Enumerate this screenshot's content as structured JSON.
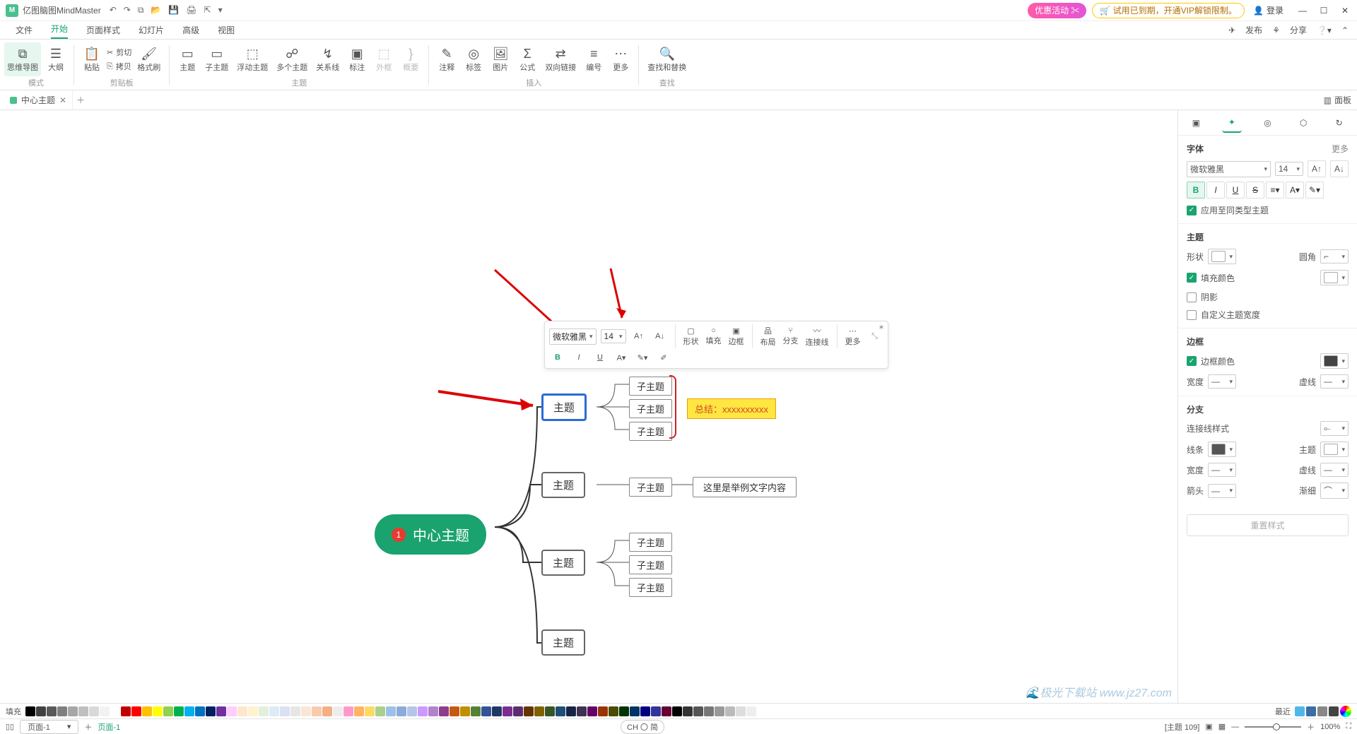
{
  "title_bar": {
    "app_name": "亿图脑图MindMaster",
    "promo1": "优惠活动 ✂",
    "promo2": "🛒 试用已到期，开通VIP解锁限制。",
    "login": "登录"
  },
  "menu": {
    "items": [
      "文件",
      "开始",
      "页面样式",
      "幻灯片",
      "高级",
      "视图"
    ],
    "active": 1
  },
  "right_icons": {
    "publish": "发布",
    "share": "分享"
  },
  "ribbon": {
    "mode": {
      "mindmap": "思维导图",
      "outline": "大纲",
      "label": "模式"
    },
    "clipboard": {
      "paste": "粘贴",
      "cut": "剪切",
      "copy": "拷贝",
      "format": "格式刷",
      "label": "剪贴板"
    },
    "topic": {
      "topic": "主题",
      "subtopic": "子主题",
      "float": "浮动主题",
      "multi": "多个主题",
      "relation": "关系线",
      "callout": "标注",
      "boundary": "外框",
      "summary": "概要",
      "label": "主题"
    },
    "insert": {
      "note": "注释",
      "tag": "标签",
      "image": "图片",
      "formula": "公式",
      "hyperlink": "双向链接",
      "number": "编号",
      "more": "更多",
      "label": "插入"
    },
    "search": {
      "find": "查找和替换",
      "label": "查找"
    }
  },
  "tab": {
    "doc_name": "中心主题",
    "panel_btn": "面板"
  },
  "canvas": {
    "center": "中心主题",
    "badge": "1",
    "topics": [
      "主题",
      "主题",
      "主题",
      "主题"
    ],
    "subs": [
      "子主题",
      "子主题",
      "子主题",
      "子主题",
      "子主题",
      "子主题",
      "子主题"
    ],
    "note1": "总结：xxxxxxxxxx",
    "note2": "这里是举例文字内容"
  },
  "float_tb": {
    "font": "微软雅黑",
    "size": "14",
    "shape": "形状",
    "fill": "填充",
    "border": "边框",
    "layout": "布局",
    "branch": "分支",
    "connector": "连接线",
    "more": "更多"
  },
  "side": {
    "font_h": "字体",
    "more": "更多",
    "font": "微软雅黑",
    "size": "14",
    "apply_all": "应用至同类型主题",
    "topic_h": "主题",
    "shape_l": "形状",
    "corner_l": "圆角",
    "fill_l": "填充颜色",
    "shadow_l": "阴影",
    "custom_w_l": "自定义主题宽度",
    "border_h": "边框",
    "border_color_l": "边框颜色",
    "width_l": "宽度",
    "dash_l": "虚线",
    "branch_h": "分支",
    "conn_style_l": "连接线样式",
    "line_l": "线条",
    "topic_l": "主题",
    "arrow_l": "箭头",
    "taper_l": "渐细",
    "reset": "重置样式"
  },
  "colorstrip": {
    "fill_l": "填充",
    "recent": "最近"
  },
  "status": {
    "page_sel": "页面-1",
    "page_link": "页面-1",
    "ime": "CH 〇 简",
    "node_count": "[主题 109]",
    "zoom": "100%"
  },
  "watermark": "🌊极光下载站 www.jz27.com",
  "color_swatches": [
    "#000",
    "#404040",
    "#595959",
    "#7f7f7f",
    "#a6a6a6",
    "#bfbfbf",
    "#d9d9d9",
    "#f2f2f2",
    "#ffffff",
    "#c00000",
    "#ff0000",
    "#ffc000",
    "#ffff00",
    "#92d050",
    "#00b050",
    "#00b0f0",
    "#0070c0",
    "#002060",
    "#7030a0",
    "#ffccff",
    "#ffe6cc",
    "#fff2cc",
    "#e2efda",
    "#ddebf7",
    "#d9e1f2",
    "#e7e6e6",
    "#fce4d6",
    "#f8cbad",
    "#f4b084",
    "#ededed",
    "#ff99cc",
    "#ffb366",
    "#ffd966",
    "#a9d08e",
    "#9bc2e6",
    "#8ea9db",
    "#b4c6e7",
    "#cc99ff",
    "#b084cc",
    "#8c3d8c",
    "#c65911",
    "#bf8f00",
    "#548235",
    "#305496",
    "#203764",
    "#7b2e8f",
    "#5b2d70",
    "#663300",
    "#806000",
    "#375623",
    "#1f4e78",
    "#152347",
    "#3f3151",
    "#660066",
    "#993300",
    "#4c4c00",
    "#003300",
    "#003366",
    "#000080",
    "#333399",
    "#660033",
    "#000",
    "#333",
    "#555",
    "#777",
    "#999",
    "#bbb",
    "#ddd",
    "#eee"
  ]
}
